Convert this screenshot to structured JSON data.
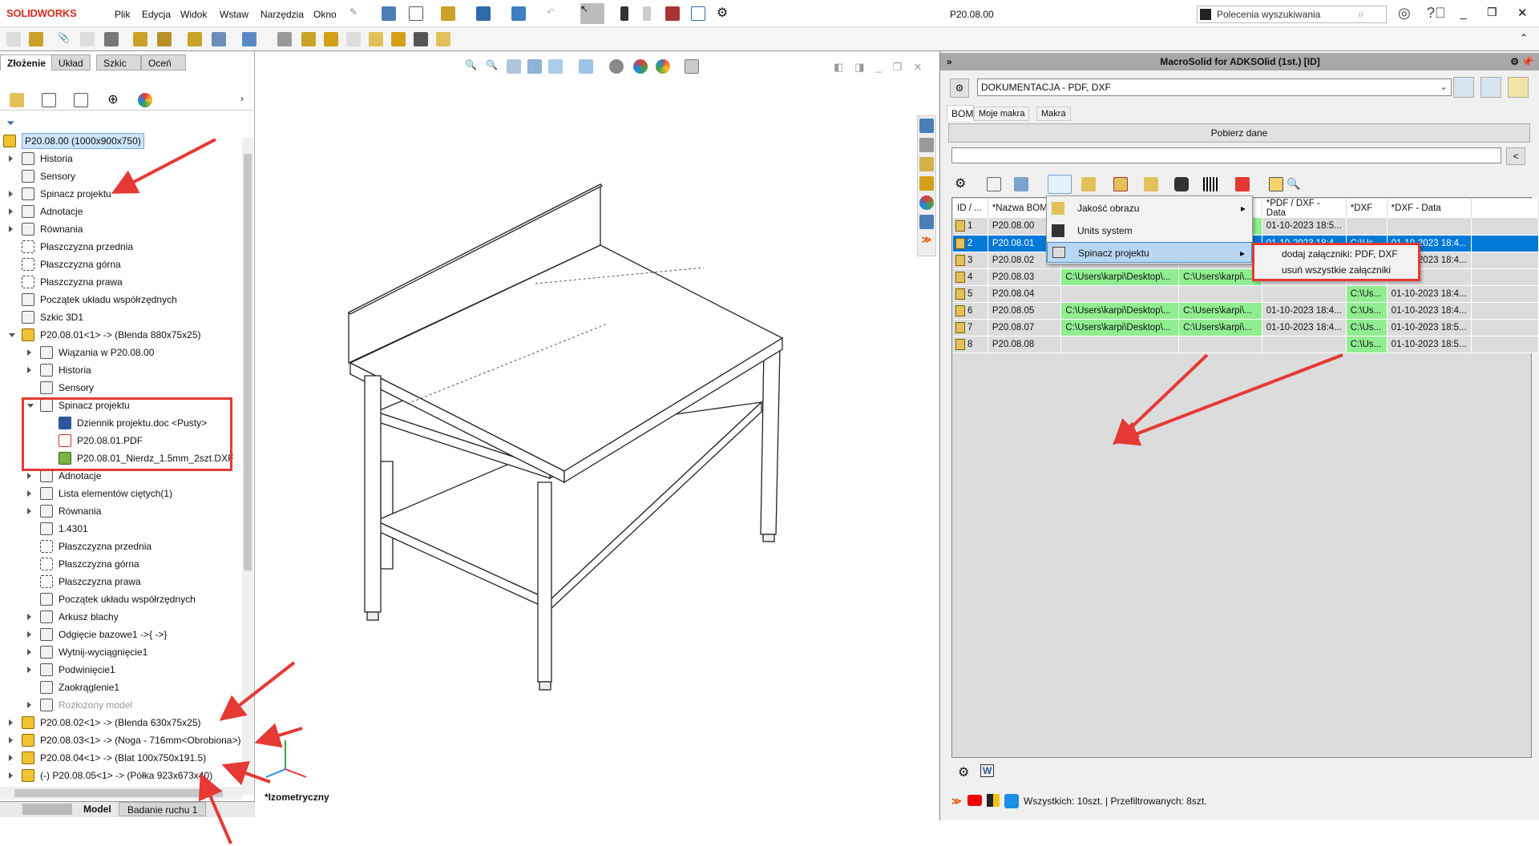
{
  "app": {
    "logo": "SOLIDWORKS",
    "document_title": "P20.08.00",
    "search_placeholder": "Polecenia wyszukiwania",
    "menus": [
      "Plik",
      "Edycja",
      "Widok",
      "Wstaw",
      "Narzędzia",
      "Okno"
    ]
  },
  "left_panel": {
    "tabs": [
      "Złożenie",
      "Układ",
      "Szkic",
      "Oceń"
    ],
    "active_tab": "Złożenie",
    "bottom_tabs": [
      "Model",
      "Badanie ruchu 1"
    ],
    "tree": [
      {
        "level": 0,
        "exp": "",
        "icon": "asm",
        "label": "P20.08.00 (1000x900x750)",
        "selected": true
      },
      {
        "level": 1,
        "exp": "c",
        "icon": "folder-history",
        "label": "Historia"
      },
      {
        "level": 1,
        "exp": "",
        "icon": "folder-sensor",
        "label": "Sensory"
      },
      {
        "level": 1,
        "exp": "c",
        "icon": "folder",
        "label": "Spinacz projektu"
      },
      {
        "level": 1,
        "exp": "c",
        "icon": "folder-annotation",
        "label": "Adnotacje"
      },
      {
        "level": 1,
        "exp": "c",
        "icon": "folder-equation",
        "label": "Równania"
      },
      {
        "level": 1,
        "exp": "",
        "icon": "plane",
        "label": "Płaszczyzna przednia"
      },
      {
        "level": 1,
        "exp": "",
        "icon": "plane",
        "label": "Płaszczyzna górna"
      },
      {
        "level": 1,
        "exp": "",
        "icon": "plane",
        "label": "Płaszczyzna prawa"
      },
      {
        "level": 1,
        "exp": "",
        "icon": "origin",
        "label": "Początek układu współrzędnych"
      },
      {
        "level": 1,
        "exp": "",
        "icon": "sketch3d",
        "label": "Szkic 3D1"
      },
      {
        "level": 1,
        "exp": "e",
        "icon": "part",
        "label": "P20.08.01<1> -> (Blenda 880x75x25)"
      },
      {
        "level": 2,
        "exp": "c",
        "icon": "folder-mates",
        "label": "Wiązania w P20.08.00"
      },
      {
        "level": 2,
        "exp": "c",
        "icon": "folder-history",
        "label": "Historia"
      },
      {
        "level": 2,
        "exp": "",
        "icon": "folder-sensor",
        "label": "Sensory"
      },
      {
        "level": 2,
        "exp": "e",
        "icon": "folder",
        "label": "Spinacz projektu"
      },
      {
        "level": 3,
        "exp": "",
        "icon": "doc",
        "label": "Dziennik projektu.doc <Pusty>"
      },
      {
        "level": 3,
        "exp": "",
        "icon": "pdf",
        "label": "P20.08.01.PDF"
      },
      {
        "level": 3,
        "exp": "",
        "icon": "dxf",
        "label": "P20.08.01_Nierdz_1.5mm_2szt.DXF"
      },
      {
        "level": 2,
        "exp": "c",
        "icon": "folder-annotation",
        "label": "Adnotacje"
      },
      {
        "level": 2,
        "exp": "c",
        "icon": "cutlist",
        "label": "Lista elementów ciętych(1)"
      },
      {
        "level": 2,
        "exp": "c",
        "icon": "folder-equation",
        "label": "Równania"
      },
      {
        "level": 2,
        "exp": "",
        "icon": "material",
        "label": "1.4301"
      },
      {
        "level": 2,
        "exp": "",
        "icon": "plane",
        "label": "Płaszczyzna przednia"
      },
      {
        "level": 2,
        "exp": "",
        "icon": "plane",
        "label": "Płaszczyzna górna"
      },
      {
        "level": 2,
        "exp": "",
        "icon": "plane",
        "label": "Płaszczyzna prawa"
      },
      {
        "level": 2,
        "exp": "",
        "icon": "origin",
        "label": "Początek układu współrzędnych"
      },
      {
        "level": 2,
        "exp": "c",
        "icon": "sheetmetal",
        "label": "Arkusz blachy"
      },
      {
        "level": 2,
        "exp": "c",
        "icon": "base-flange",
        "label": "Odgięcie bazowe1 ->{ ->}"
      },
      {
        "level": 2,
        "exp": "c",
        "icon": "cut-extrude",
        "label": "Wytnij-wyciągnięcie1"
      },
      {
        "level": 2,
        "exp": "c",
        "icon": "hem",
        "label": "Podwinięcie1"
      },
      {
        "level": 2,
        "exp": "",
        "icon": "fillet",
        "label": "Zaokrąglenie1"
      },
      {
        "level": 2,
        "exp": "c",
        "icon": "flat-pattern",
        "label": "Rozłożony model",
        "grey": true
      },
      {
        "level": 1,
        "exp": "c",
        "icon": "part",
        "label": "P20.08.02<1> -> (Blenda 630x75x25)"
      },
      {
        "level": 1,
        "exp": "c",
        "icon": "part",
        "label": "P20.08.03<1> -> (Noga - 716mm<Obrobiona>)"
      },
      {
        "level": 1,
        "exp": "c",
        "icon": "part",
        "label": "P20.08.04<1> -> (Blat 100x750x191.5)"
      },
      {
        "level": 1,
        "exp": "c",
        "icon": "part",
        "label": "(-) P20.08.05<1> -> (Półka 923x673x40)"
      }
    ]
  },
  "graphics": {
    "view_label": "*Izometryczny"
  },
  "macro_panel": {
    "title": "MacroSolid for ADKSOlid (1st.) [ID]",
    "profile": "DOKUMENTACJA - PDF, DXF",
    "tabs": [
      "BOM",
      "Moje makra",
      "Makra"
    ],
    "active_tab": "BOM",
    "fetch_button": "Pobierz dane",
    "filter_value": "",
    "filter_clear": "<",
    "columns": [
      "ID / ...",
      "*Nazwa BOM",
      "",
      "",
      "*PDF / DXF - Data",
      "*DXF",
      "*DXF - Data"
    ],
    "rows": [
      {
        "id": "1",
        "name": "P20.08.00",
        "c3": "",
        "c4": "",
        "pdfdate": "01-10-2023 18:5...",
        "dxf": "",
        "dxfdate": "",
        "green": [
          3
        ]
      },
      {
        "id": "2",
        "name": "P20.08.01",
        "c3": "",
        "c4": "",
        "pdfdate": "01-10-2023 18:4...",
        "dxf": "C:\\Us...",
        "dxfdate": "01-10-2023 18:4...",
        "selected": true,
        "green": []
      },
      {
        "id": "3",
        "name": "P20.08.02",
        "c3": "",
        "c4": "",
        "pdfdate": "",
        "dxf": "",
        "dxfdate": "01-10-2023 18:4...",
        "green": []
      },
      {
        "id": "4",
        "name": "P20.08.03",
        "c3": "C:\\Users\\karpi\\Desktop\\...",
        "c4": "C:\\Users\\karpi\\...",
        "pdfdate": "",
        "dxf": "",
        "dxfdate": "",
        "green": [
          2,
          3
        ]
      },
      {
        "id": "5",
        "name": "P20.08.04",
        "c3": "",
        "c4": "",
        "pdfdate": "",
        "dxf": "C:\\Us...",
        "dxfdate": "01-10-2023 18:4...",
        "green": [
          5
        ]
      },
      {
        "id": "6",
        "name": "P20.08.05",
        "c3": "C:\\Users\\karpi\\Desktop\\...",
        "c4": "C:\\Users\\karpi\\...",
        "pdfdate": "01-10-2023 18:4...",
        "dxf": "C:\\Us...",
        "dxfdate": "01-10-2023 18:4...",
        "green": [
          2,
          3,
          5
        ]
      },
      {
        "id": "7",
        "name": "P20.08.07",
        "c3": "C:\\Users\\karpi\\Desktop\\...",
        "c4": "C:\\Users\\karpi\\...",
        "pdfdate": "01-10-2023 18:4...",
        "dxf": "C:\\Us...",
        "dxfdate": "01-10-2023 18:5...",
        "green": [
          2,
          3,
          5
        ]
      },
      {
        "id": "8",
        "name": "P20.08.08",
        "c3": "",
        "c4": "",
        "pdfdate": "",
        "dxf": "C:\\Us...",
        "dxfdate": "01-10-2023 18:5...",
        "green": [
          5
        ]
      }
    ],
    "context_menu": {
      "items": [
        "Jakość obrazu",
        "Units system",
        "Spinacz projektu"
      ],
      "highlighted": "Spinacz projektu",
      "submenu": [
        "dodaj załączniki: PDF, DXF",
        "usuń wszystkie załączniki"
      ]
    },
    "status": "Wszystkich: 10szt. | Przefiltrowanych: 8szt."
  },
  "colors": {
    "selection": "#0078d7",
    "green_cell": "#90ee90",
    "annotation_red": "#e53935",
    "menu_highlight": "#b9d7f2"
  }
}
